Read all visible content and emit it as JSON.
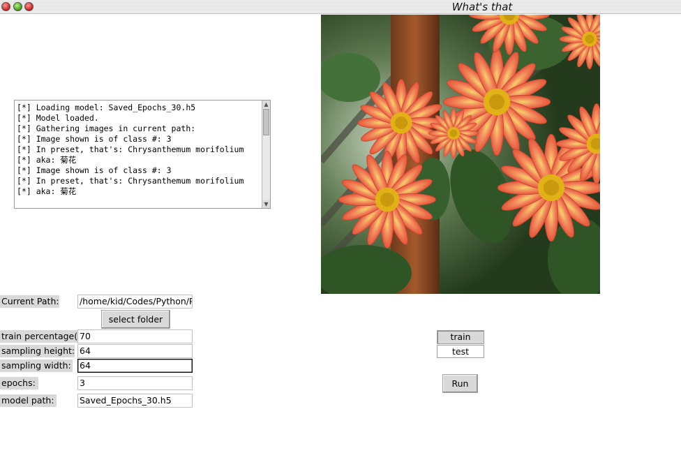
{
  "window": {
    "title": "What's that"
  },
  "log": {
    "lines": [
      "[*] Loading model: Saved_Epochs_30.h5",
      "[*] Model loaded.",
      "[*] Gathering images in current path:",
      "[*] Image shown is of class #: 3",
      "[*] In preset, that's: Chrysanthemum morifolium",
      "[*] aka: 菊花",
      "[*] Image shown is of class #: 3",
      "[*] In preset, that's: Chrysanthemum morifolium",
      "[*] aka: 菊花"
    ]
  },
  "form": {
    "current_path_label": "Current Path:",
    "current_path_value": "/home/kid/Codes/Python/Py",
    "select_folder_label": "select folder",
    "train_percentage_label": "train percentage(%",
    "train_percentage_value": "70",
    "sampling_height_label": "sampling height:",
    "sampling_height_value": "64",
    "sampling_width_label": "sampling width:",
    "sampling_width_value": "64",
    "epochs_label": "epochs:",
    "epochs_value": "3",
    "model_path_label": "model path:",
    "model_path_value": "Saved_Epochs_30.h5"
  },
  "mode": {
    "train_label": "train",
    "test_label": "test",
    "selected": "train"
  },
  "actions": {
    "run_label": "Run"
  },
  "colors": {
    "widget_bg": "#d9d9d9",
    "window_bg": "#ffffff"
  }
}
